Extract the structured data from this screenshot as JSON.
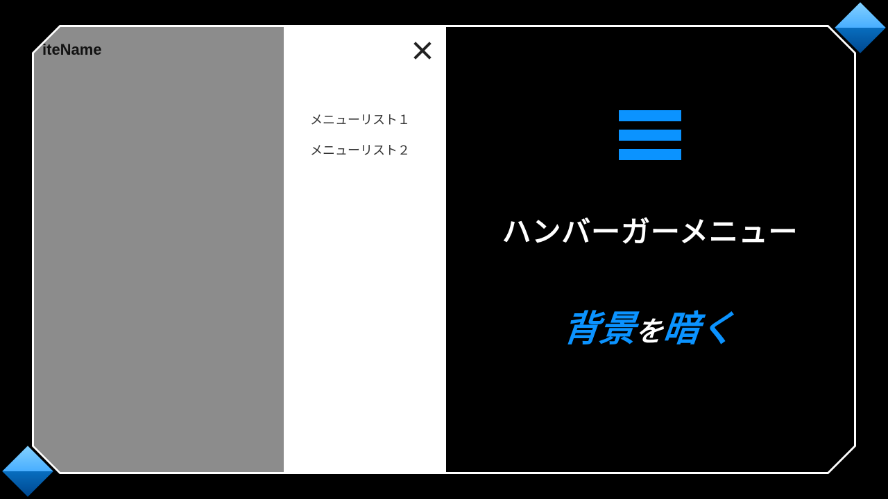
{
  "mockup": {
    "site_name": "iteName",
    "menu_items": [
      "メニューリスト１",
      "メニューリスト２"
    ]
  },
  "labels": {
    "title_main": "ハンバーガーメニュー",
    "sub_accent1": "背景",
    "sub_small": "を",
    "sub_accent2": "暗く"
  },
  "colors": {
    "accent": "#0b93ff"
  }
}
